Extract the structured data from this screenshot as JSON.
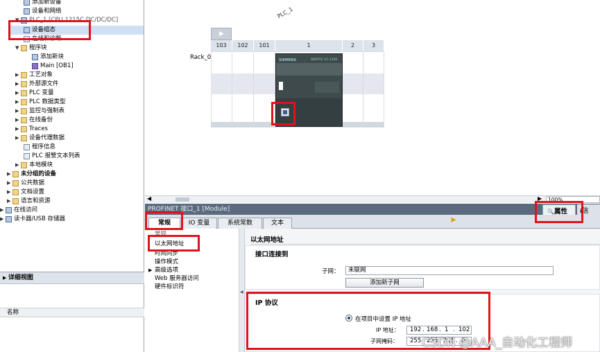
{
  "tree": {
    "items": [
      {
        "label": "添加新设备",
        "indent": 1
      },
      {
        "label": "设备和网络",
        "indent": 1
      },
      {
        "label": "PLC_1 [CPU 1215C DC/DC/DC]",
        "indent": 0
      },
      {
        "label": "设备组态",
        "indent": 2
      },
      {
        "label": "在线和诊断",
        "indent": 2
      },
      {
        "label": "程序块",
        "indent": 2
      },
      {
        "label": "添加新块",
        "indent": 3
      },
      {
        "label": "Main [OB1]",
        "indent": 3
      },
      {
        "label": "工艺对象",
        "indent": 2
      },
      {
        "label": "外部源文件",
        "indent": 2
      },
      {
        "label": "PLC 变量",
        "indent": 2
      },
      {
        "label": "PLC 数据类型",
        "indent": 2
      },
      {
        "label": "监控与强制表",
        "indent": 2
      },
      {
        "label": "在线备份",
        "indent": 2
      },
      {
        "label": "Traces",
        "indent": 2
      },
      {
        "label": "设备代理数据",
        "indent": 2
      },
      {
        "label": "程序信息",
        "indent": 2
      },
      {
        "label": "PLC 报警文本列表",
        "indent": 2
      },
      {
        "label": "本地模块",
        "indent": 2
      },
      {
        "label": "未分组的设备",
        "indent": 1
      },
      {
        "label": "公共数据",
        "indent": 1
      },
      {
        "label": "文档设置",
        "indent": 1
      },
      {
        "label": "语言和资源",
        "indent": 1
      },
      {
        "label": "在线访问",
        "indent": 0
      },
      {
        "label": "读卡器/USB 存储器",
        "indent": 0
      }
    ]
  },
  "details": {
    "title": "详细视图",
    "column_name": "名称"
  },
  "device_view": {
    "plc_label": "PLC_1",
    "rack_label": "Rack_0",
    "slots": [
      "103",
      "102",
      "101",
      "1",
      "2",
      "3"
    ],
    "cpu_brand": "SIEMENS",
    "cpu_model": "SIMATIC S7-1200",
    "zoom": "100%"
  },
  "inspector": {
    "title": "PROFINET 接口_1 [Module]",
    "properties_tab": "属性",
    "info_tab": "信",
    "tabs": [
      "常规",
      "IO 变量",
      "系统常数",
      "文本"
    ],
    "nav": [
      "常规",
      "以太网地址",
      "时间同步",
      "操作模式",
      "高级选项",
      "Web 服务器访问",
      "硬件标识符"
    ],
    "section_title": "以太网地址",
    "interface_header": "接口连接到",
    "subnet_label": "子网：",
    "subnet_value": "未联网",
    "add_subnet_button": "添加新子网",
    "ip_header": "IP 协议",
    "ip_radio_label": "在项目中设置 IP 地址",
    "ip_label": "IP 地址：",
    "ip_octets": [
      "192",
      "168",
      "1",
      "102"
    ],
    "mask_label": "子网掩码：",
    "mask_octets": [
      "255",
      "255",
      "255",
      "0"
    ]
  },
  "watermark": "CSDN @AAA_自动化工程师",
  "colors": {
    "highlight": "#e0121b",
    "title_bar": "#5b6b7d",
    "slot_header": "#dde3eb",
    "cpu_body": "#3e4a4c"
  }
}
